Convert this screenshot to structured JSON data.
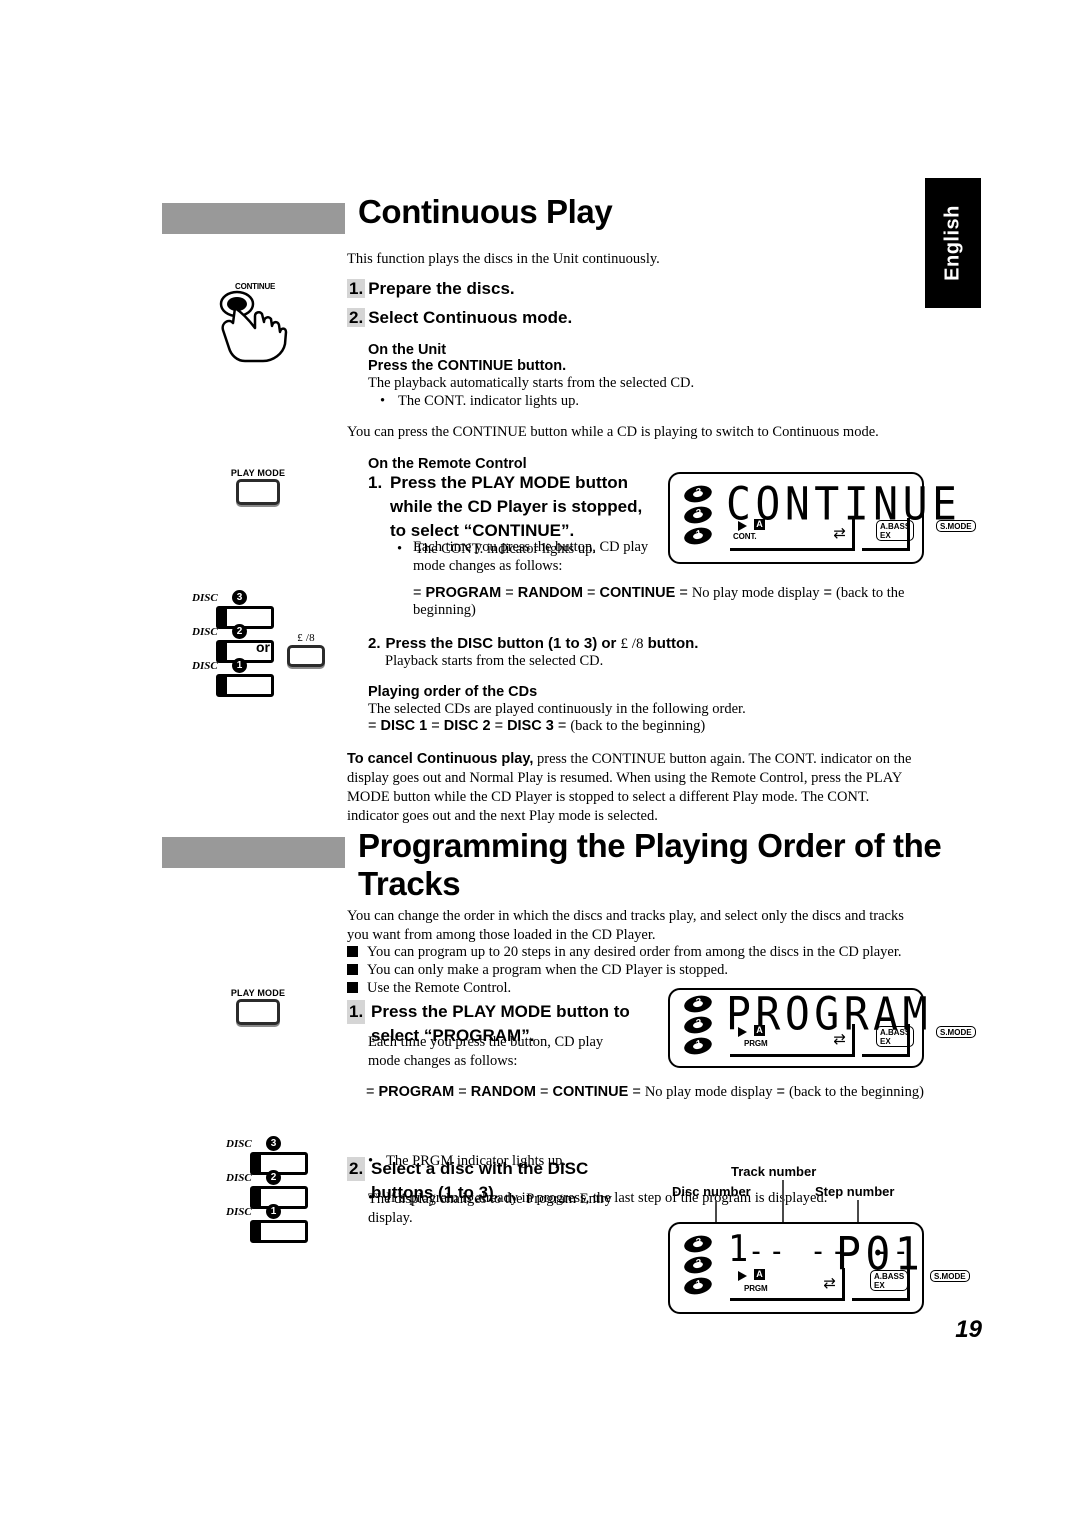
{
  "page": {
    "language_tab": "English",
    "page_number": "19"
  },
  "section1": {
    "title": "Continuous Play",
    "intro": "This function plays the discs in the Unit continuously.",
    "step1": {
      "num": "1.",
      "text": "Prepare the discs."
    },
    "step2": {
      "num": "2.",
      "text": "Select Continuous mode."
    },
    "on_the_unit_heading": "On the Unit",
    "on_the_unit_action": "Press the CONTINUE button.",
    "on_the_unit_body": "The playback automatically starts from the selected CD.",
    "on_the_unit_bullet": "The CONT. indicator lights up.",
    "switch_note": "You can press the CONTINUE button while a CD is playing to switch to Continuous mode.",
    "remote_heading": "On the Remote Control",
    "remote_step1_num": "1.",
    "remote_step1_text": "Press the PLAY MODE button while the CD Player is stopped, to select “CONTINUE”.",
    "remote_bullet1": "The CONT. indicator lights up.",
    "remote_bullet2": "Each time you press the button, CD play mode changes as follows:",
    "mode_flow": {
      "arrow": "=",
      "items": [
        "PROGRAM",
        "RANDOM",
        "CONTINUE"
      ],
      "plain_item": "No play mode display",
      "tail": "(back to the beginning)"
    },
    "remote_step2_num": "2.",
    "remote_step2_text_a": "Press the DISC button (1 to 3) or",
    "remote_step2_symbol": "£ /8",
    "remote_step2_text_b": "button.",
    "remote_step2_body": "Playback starts from the selected CD.",
    "order_heading": "Playing order of the CDs",
    "order_body": "The selected CDs are played continuously in the following order.",
    "order_flow": {
      "items": [
        "DISC 1",
        "DISC 2",
        "DISC 3"
      ],
      "tail": "(back to the beginning)"
    },
    "cancel_lead": "To cancel Continuous play,",
    "cancel_body": "press the CONTINUE button again. The CONT. indicator on the display goes out and Normal Play is resumed. When using the Remote Control, press the PLAY MODE button while the CD Player is stopped to select a different Play mode. The CONT. indicator goes out and the next Play mode is selected."
  },
  "section2": {
    "title": "Programming the Playing Order of the Tracks",
    "intro": "You can change the order in which the discs and tracks play, and select only the discs and tracks you want from among those loaded in the CD Player.",
    "bullets": [
      "You can program up to 20 steps in any desired order from among the discs in the CD player.",
      "You can only make a program when the CD Player is stopped.",
      "Use the Remote Control."
    ],
    "step1_num": "1.",
    "step1_text": "Press the PLAY MODE button to select “PROGRAM”.",
    "step1_body": "Each time you press the button, CD play mode changes as follows:",
    "mode_flow": {
      "items": [
        "PROGRAM",
        "RANDOM",
        "CONTINUE"
      ],
      "plain_item": "No play mode display",
      "tail": "(back to the beginning)"
    },
    "step1_bullet1": "The PRGM indicator lights up.",
    "step1_bullet2": "If a program is already in progress, the last step of the program is displayed.",
    "step2_num": "2.",
    "step2_text": "Select a disc with the DISC buttons  (1 to 3).",
    "step2_body": "The display changes to the Program Entry display.",
    "callouts": {
      "disc_number": "Disc number",
      "track_number": "Track number",
      "step_number": "Step number"
    }
  },
  "artwork": {
    "continue_button_label": "CONTINUE",
    "play_mode_button_label": "PLAY MODE",
    "disc_label": "DISC",
    "disc_numbers": [
      "3",
      "2",
      "1"
    ],
    "or_label": "or",
    "play_pause_label": "£ /8"
  },
  "lcd": {
    "continue": {
      "main_text": "CONTINUE",
      "disc_icons": [
        "3",
        "2",
        "1"
      ],
      "mode_indicator": "CONT.",
      "a_indicator": "A",
      "bass_indicator": "A.BASS EX",
      "smode_indicator": "S.MODE"
    },
    "program": {
      "main_text": "PROGRAM",
      "disc_icons": [
        "3",
        "2",
        "1"
      ],
      "mode_indicator": "PRGM",
      "a_indicator": "A",
      "bass_indicator": "A.BASS EX",
      "smode_indicator": "S.MODE"
    },
    "program_entry": {
      "disc_digit": "1",
      "track_digits": "-- -- --",
      "step_text": "P01",
      "disc_icons": [
        "3",
        "2",
        "1"
      ],
      "mode_indicator": "PRGM",
      "a_indicator": "A",
      "bass_indicator": "A.BASS EX",
      "smode_indicator": "S.MODE"
    }
  }
}
